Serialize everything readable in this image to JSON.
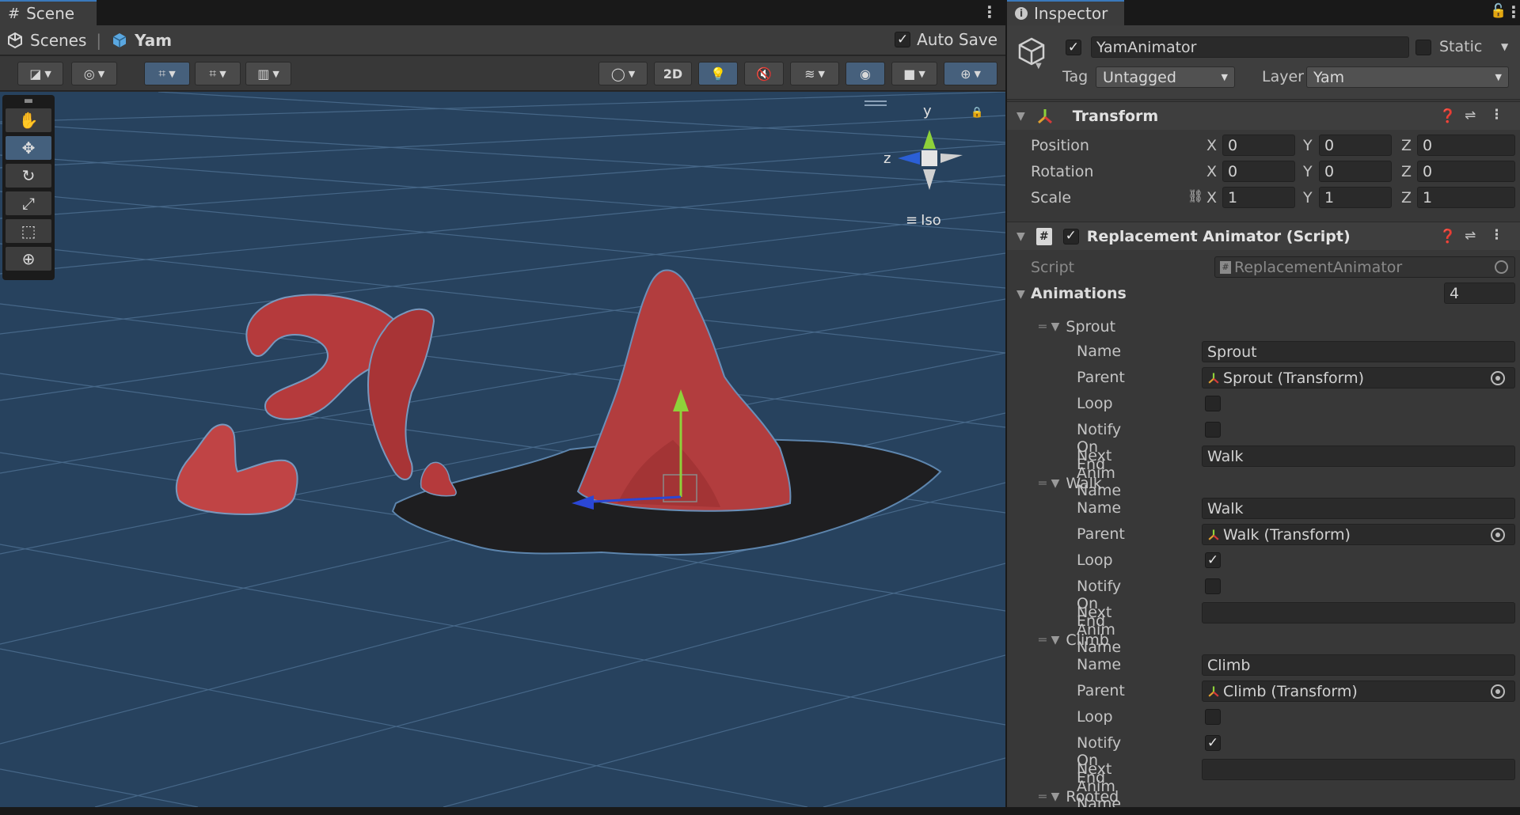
{
  "scene": {
    "tab_label": "Scene",
    "breadcrumb": {
      "root": "Scenes",
      "current": "Yam"
    },
    "auto_save": {
      "label": "Auto Save",
      "checked": true
    },
    "toolbar": {
      "mode_2d": "2D"
    },
    "gizmo": {
      "y_label": "y",
      "z_label": "z",
      "projection": "Iso"
    },
    "tools": [
      "hand-tool",
      "move-tool",
      "rotate-tool",
      "scale-tool",
      "rect-tool",
      "transform-tool"
    ]
  },
  "inspector": {
    "tab_label": "Inspector",
    "object": {
      "active": true,
      "name": "YamAnimator",
      "static_label": "Static",
      "static": false,
      "tag_label": "Tag",
      "tag_value": "Untagged",
      "layer_label": "Layer",
      "layer_value": "Yam"
    },
    "transform": {
      "title": "Transform",
      "position": {
        "label": "Position",
        "x": "0",
        "y": "0",
        "z": "0"
      },
      "rotation": {
        "label": "Rotation",
        "x": "0",
        "y": "0",
        "z": "0"
      },
      "scale": {
        "label": "Scale",
        "x": "1",
        "y": "1",
        "z": "1"
      },
      "axis_x": "X",
      "axis_y": "Y",
      "axis_z": "Z"
    },
    "script_component": {
      "title": "Replacement Animator (Script)",
      "enabled": true,
      "script_label": "Script",
      "script_value": "ReplacementAnimator",
      "animations_label": "Animations",
      "animations_count": "4",
      "field_labels": {
        "name": "Name",
        "parent": "Parent",
        "loop": "Loop",
        "notify": "Notify On End",
        "next": "Next Anim Name"
      },
      "animations": [
        {
          "header": "Sprout",
          "name": "Sprout",
          "parent": "Sprout (Transform)",
          "loop": false,
          "notify_on_end": false,
          "next_anim_name": "Walk"
        },
        {
          "header": "Walk",
          "name": "Walk",
          "parent": "Walk (Transform)",
          "loop": true,
          "notify_on_end": false,
          "next_anim_name": ""
        },
        {
          "header": "Climb",
          "name": "Climb",
          "parent": "Climb (Transform)",
          "loop": false,
          "notify_on_end": true,
          "next_anim_name": ""
        },
        {
          "header": "Rooted"
        }
      ]
    }
  },
  "colors": {
    "viewport_bg": "#27425e",
    "grid_line": "#4c6e90",
    "yam_red": "#b5383a",
    "selection_blue": "#3a79bb"
  }
}
